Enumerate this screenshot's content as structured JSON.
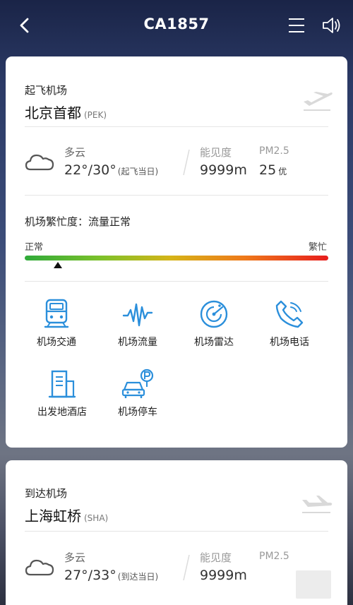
{
  "header": {
    "title": "CA1857"
  },
  "departure": {
    "label": "起飞机场",
    "airport_name": "北京首都",
    "airport_code": "(PEK)",
    "weather": {
      "condition": "多云",
      "temperature": "22°/30°",
      "temperature_note": "(起飞当日)",
      "visibility_label": "能见度",
      "visibility_value": "9999m",
      "pm_label": "PM2.5",
      "pm_value": "25",
      "pm_grade": "优"
    },
    "busyness": {
      "title": "机场繁忙度：流量正常",
      "low_label": "正常",
      "high_label": "繁忙",
      "level": 0.11
    },
    "services": [
      {
        "label": "机场交通",
        "icon": "train-icon"
      },
      {
        "label": "机场流量",
        "icon": "pulse-icon"
      },
      {
        "label": "机场雷达",
        "icon": "radar-icon"
      },
      {
        "label": "机场电话",
        "icon": "phone-icon"
      },
      {
        "label": "出发地酒店",
        "icon": "hotel-icon"
      },
      {
        "label": "机场停车",
        "icon": "parking-icon"
      }
    ]
  },
  "arrival": {
    "label": "到达机场",
    "airport_name": "上海虹桥",
    "airport_code": "(SHA)",
    "weather": {
      "condition": "多云",
      "temperature": "27°/33°",
      "temperature_note": "(到达当日)",
      "visibility_label": "能见度",
      "visibility_value": "9999m",
      "pm_label": "PM2.5"
    }
  },
  "colors": {
    "accent": "#2b8fdb",
    "busy_low": "#2faa3a",
    "busy_high": "#e71d1d"
  }
}
